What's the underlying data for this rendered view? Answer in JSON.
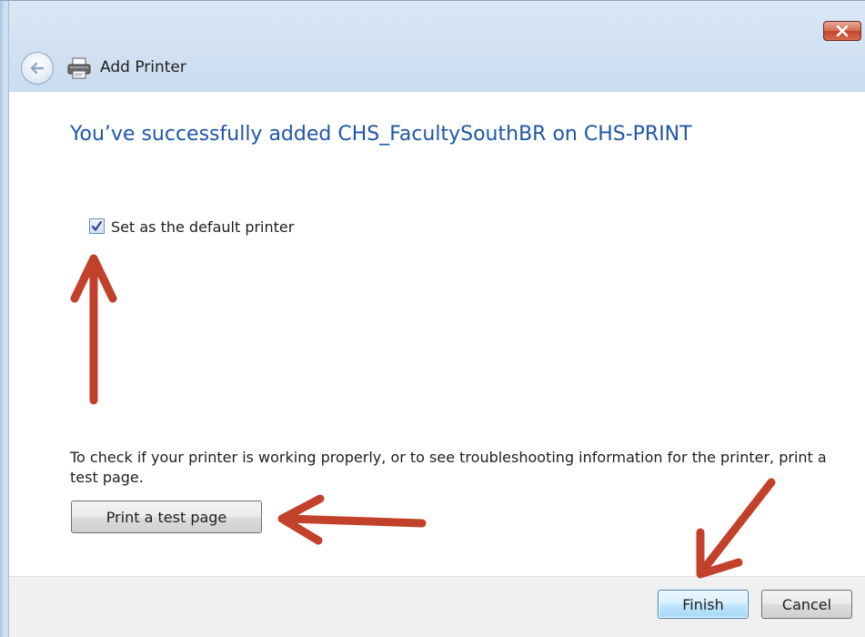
{
  "window": {
    "title": "Add Printer",
    "close_label": "×"
  },
  "wizard": {
    "heading": "You’ve successfully added CHS_FacultySouthBR on CHS-PRINT",
    "default_checkbox": {
      "label": "Set as the default printer",
      "checked": true
    },
    "info_text": "To check if your printer is working properly, or to see troubleshooting information for the printer, print a test page.",
    "test_page_button": "Print a test page"
  },
  "footer": {
    "finish_label": "Finish",
    "cancel_label": "Cancel"
  },
  "colors": {
    "heading": "#1f56a5",
    "annotation_arrow": "#c2412a",
    "close_button": "#c2432a"
  },
  "icons": [
    "back-arrow-icon",
    "printer-icon",
    "close-icon",
    "checkmark-icon"
  ]
}
